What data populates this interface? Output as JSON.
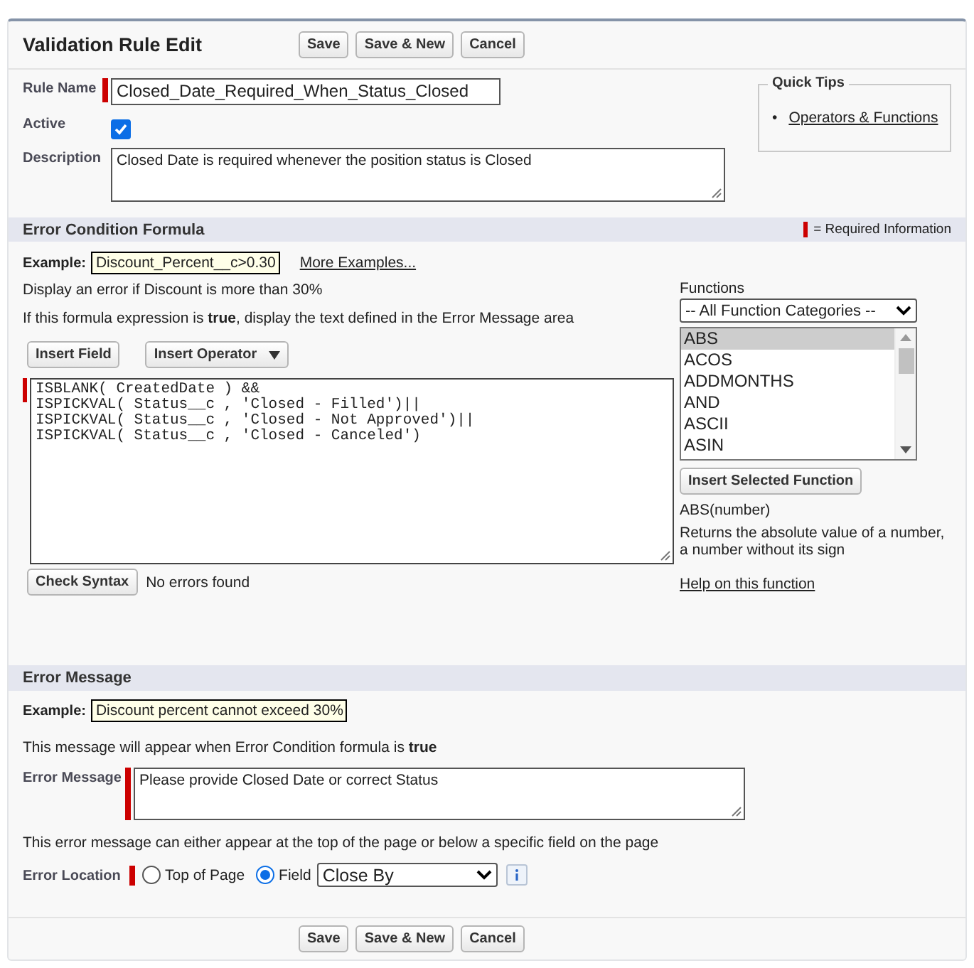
{
  "header": {
    "title": "Validation Rule Edit",
    "buttons": [
      "Save",
      "Save & New",
      "Cancel"
    ]
  },
  "fields": {
    "rule_name": {
      "label": "Rule Name",
      "value": "Closed_Date_Required_When_Status_Closed"
    },
    "active": {
      "label": "Active",
      "checked": true
    },
    "description": {
      "label": "Description",
      "value": "Closed Date is required whenever the position status is Closed"
    }
  },
  "quick_tips": {
    "title": "Quick Tips",
    "bullet": "•",
    "links": [
      "Operators & Functions"
    ]
  },
  "formula_section": {
    "title": "Error Condition Formula",
    "required_legend": "= Required Information",
    "example_label": "Example:",
    "example": "Discount_Percent__c>0.30",
    "more_examples": "More Examples...",
    "hint": "Display an error if Discount is more than 30%",
    "instruction": "If this formula expression is **true**, display the text defined in the Error Message area",
    "insert_field": "Insert Field",
    "insert_operator": "Insert Operator",
    "formula_lines": [
      "ISBLANK( CreatedDate ) &&",
      "ISPICKVAL( Status__c , 'Closed - Filled')||",
      "ISPICKVAL( Status__c , 'Closed - Not Approved')||",
      "ISPICKVAL( Status__c , 'Closed - Canceled')"
    ],
    "check_syntax": "Check Syntax",
    "syntax_result": "No errors found",
    "functions": {
      "label": "Functions",
      "category": "-- All Function Categories --",
      "items": [
        {
          "name": "ABS",
          "selected": true
        },
        {
          "name": "ACOS",
          "selected": false
        },
        {
          "name": "ADDMONTHS",
          "selected": false
        },
        {
          "name": "AND",
          "selected": false
        },
        {
          "name": "ASCII",
          "selected": false
        },
        {
          "name": "ASIN",
          "selected": false
        }
      ],
      "insert_button": "Insert Selected Function",
      "signature": "ABS(number)",
      "description": "Returns the absolute value of a number, a number without its sign",
      "help_link": "Help on this function"
    }
  },
  "error_message_section": {
    "title": "Error Message",
    "example_label": "Example:",
    "example": "Discount percent cannot exceed 30%",
    "note": "This message will appear when Error Condition formula is **true**",
    "message_label": "Error Message",
    "message": "Please provide Closed Date or correct Status",
    "location_note": "This error message can either appear at the top of the page or below a specific field on the page",
    "location_label": "Error Location",
    "location_options": [
      {
        "label": "Top of Page",
        "selected": false
      },
      {
        "label": "Field",
        "selected": true
      }
    ],
    "location_field": "Close By"
  },
  "footer": {
    "buttons": [
      "Save",
      "Save & New",
      "Cancel"
    ]
  }
}
